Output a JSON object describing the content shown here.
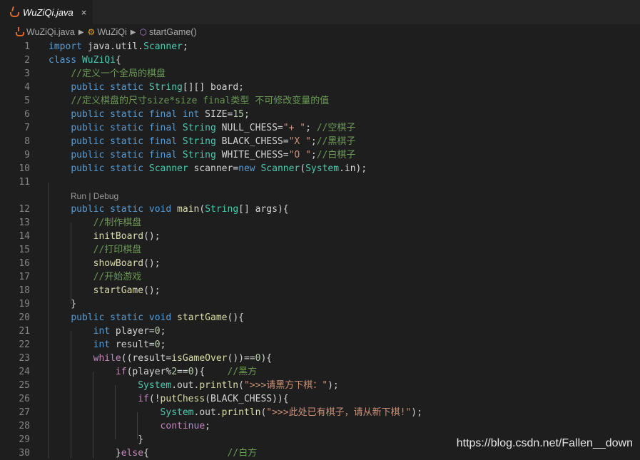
{
  "tab": {
    "label": "WuZiQi.java",
    "close": "×"
  },
  "breadcrumb": {
    "file": "WuZiQi.java",
    "class": "WuZiQi",
    "method": "startGame()"
  },
  "codelens": "Run | Debug",
  "line_numbers": [
    "1",
    "2",
    "3",
    "4",
    "5",
    "6",
    "7",
    "8",
    "9",
    "10",
    "11",
    "12",
    "13",
    "14",
    "15",
    "16",
    "17",
    "18",
    "19",
    "20",
    "21",
    "22",
    "23",
    "24",
    "25",
    "26",
    "27",
    "28",
    "29",
    "30"
  ],
  "code_lines": [
    "import java.util.Scanner;",
    "class WuZiQi{",
    "    //定义一个全局的棋盘",
    "    public static String[][] board;",
    "    //定义棋盘的尺寸size*size final类型 不可修改变量的值",
    "    public static final int SIZE=15;",
    "    public static final String NULL_CHESS=\"+ \"; //空棋子",
    "    public static final String BLACK_CHESS=\"X \";//黑棋子",
    "    public static final String WHITE_CHESS=\"O \";//白棋子",
    "    public static Scanner scanner=new Scanner(System.in);",
    "",
    "    public static void main(String[] args){",
    "        //制作棋盘",
    "        initBoard();",
    "        //打印棋盘",
    "        showBoard();",
    "        //开始游戏",
    "        startGame();",
    "    }",
    "    public static void startGame(){",
    "        int player=0;",
    "        int result=0;",
    "        while((result=isGameOver())==0){",
    "            if(player%2==0){    //黑方",
    "                System.out.println(\">>>请黑方下棋：\");",
    "                if(!putChess(BLACK_CHESS)){",
    "                    System.out.println(\">>>此处已有棋子，请从新下棋!\");",
    "                    continue;",
    "                }",
    "            }else{              //白方"
  ],
  "watermark": "https://blog.csdn.net/Fallen__down",
  "colors": {
    "background": "#1e1e1e",
    "keyword": "#569cd6",
    "control": "#c586c0",
    "type": "#4ec9b0",
    "comment": "#6a9955",
    "string": "#ce9178",
    "number": "#b5cea8",
    "function": "#dcdcaa",
    "line_number": "#858585"
  }
}
